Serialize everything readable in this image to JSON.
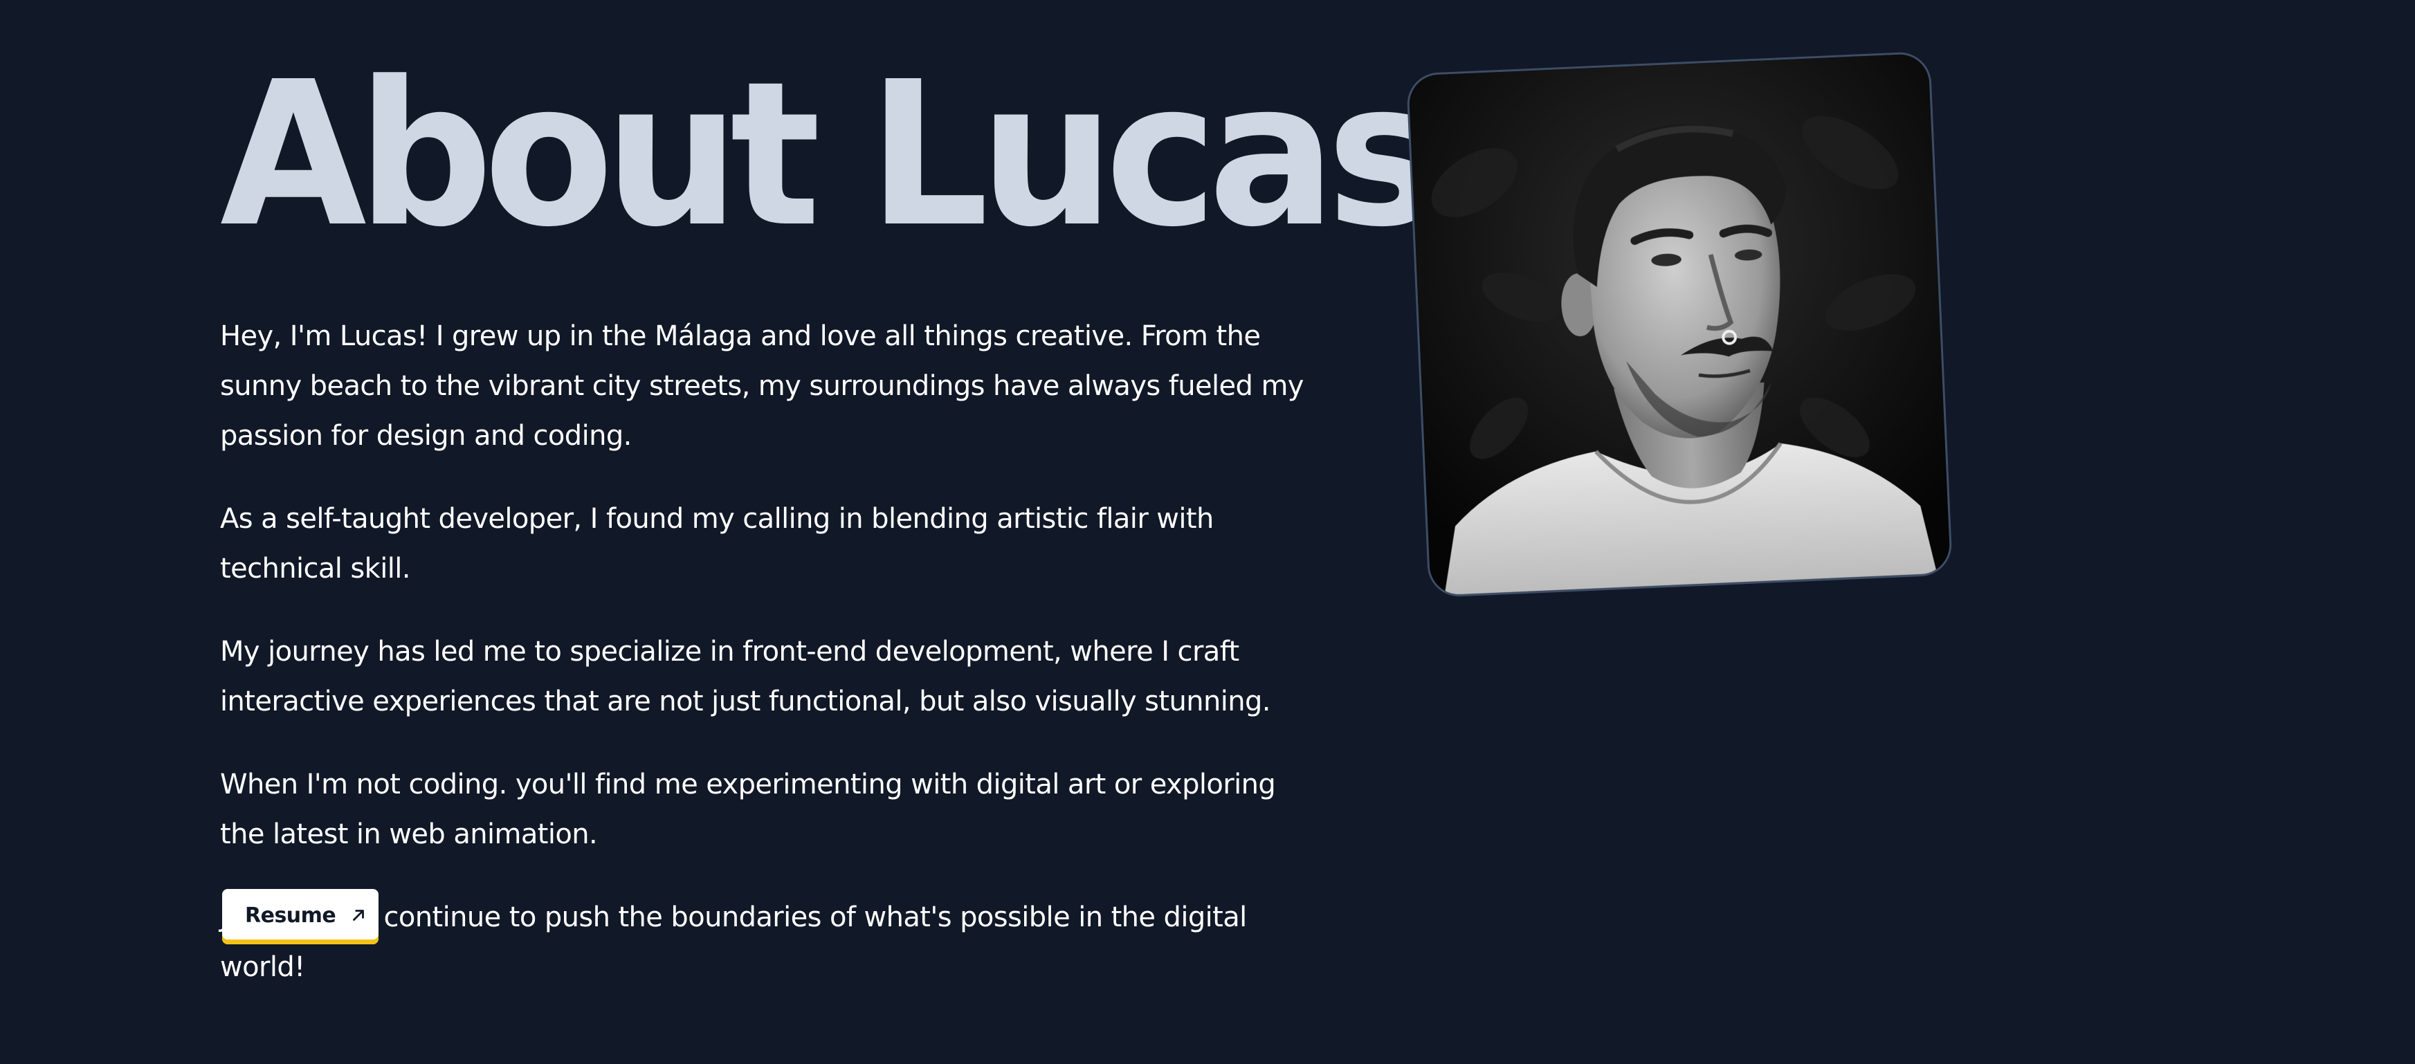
{
  "page": {
    "background": "#111827",
    "title": "About Lucas",
    "title_color": "#cfd6e4"
  },
  "bio": {
    "paragraphs": [
      "Hey, I'm Lucas! I grew up in the Málaga and love all things creative. From the sunny beach to the vibrant city streets, my surroundings have always fueled my passion for design and coding.",
      "As a self-taught developer, I found my calling in blending artistic flair with technical skill.",
      "My journey has led me to specialize in front-end development, where I craft interactive experiences that are not just functional, but also visually stunning.",
      "When I'm not coding. you'll find me experimenting with digital art or exploring the latest in web animation.",
      "Join me as I continue to push the boundaries of what's possible in the digital world!"
    ]
  },
  "resume_button": {
    "label": "Resume",
    "icon": "arrow-up-right-icon",
    "accent_color": "#f3c319"
  },
  "portrait": {
    "icon": "portrait-photo",
    "style": "black-and-white"
  }
}
